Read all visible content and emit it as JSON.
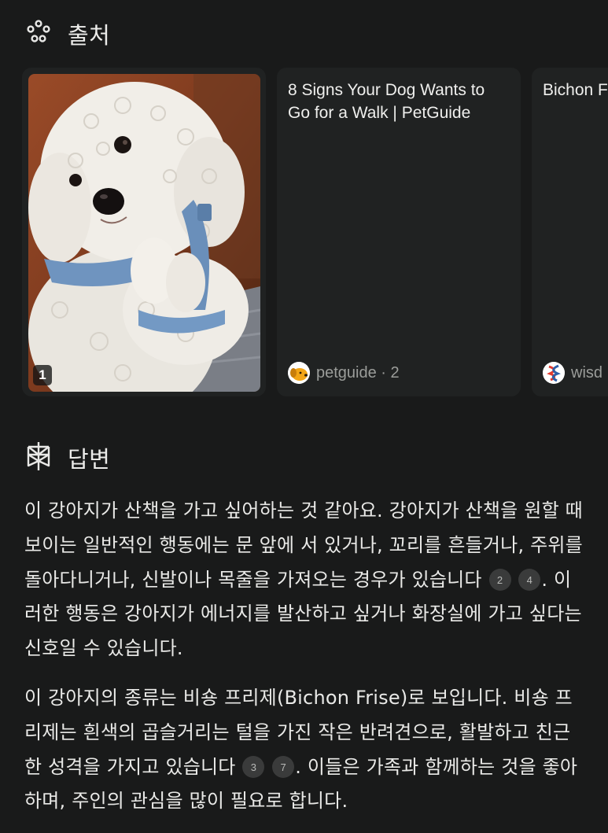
{
  "sources": {
    "title": "출처",
    "cards": [
      {
        "index": "1"
      },
      {
        "title": "8 Signs Your Dog Wants to Go for a Walk | PetGuide",
        "source": "petguide · 2",
        "favicon": "petguide-icon"
      },
      {
        "title": "Bichon F Wisdom Breeds",
        "source": "wisd",
        "favicon": "wisdom-panel-icon"
      }
    ]
  },
  "answer": {
    "title": "답변",
    "p1_a": "이 강아지가 산책을 가고 싶어하는 것 같아요. 강아지가 산책을 원할 때 보이는 일반적인 행동에는 문 앞에 서 있거나, 꼬리를 흔들거나, 주위를 돌아다니거나, 신발이나 목줄을 가져오는 경우가 있습니다",
    "p1_cite1": "2",
    "p1_cite2": "4",
    "p1_b": ". 이러한 행동은 강아지가 에너지를 발산하고 싶거나 화장실에 가고 싶다는 신호일 수 있습니다.",
    "p2_a": "이 강아지의 종류는 비숑 프리제(Bichon Frise)로 보입니다. 비숑 프리제는 흰색의 곱슬거리는 털을 가진 작은 반려견으로, 활발하고 친근한 성격을 가지고 있습니다",
    "p2_cite1": "3",
    "p2_cite2": "7",
    "p2_b": ". 이들은 가족과 함께하는 것을 좋아하며, 주인의 관심을 많이 필요로 합니다."
  },
  "colors": {
    "background": "#191a1a",
    "card": "#202222",
    "text": "#e9e9e7",
    "muted": "#9b9d9a"
  }
}
